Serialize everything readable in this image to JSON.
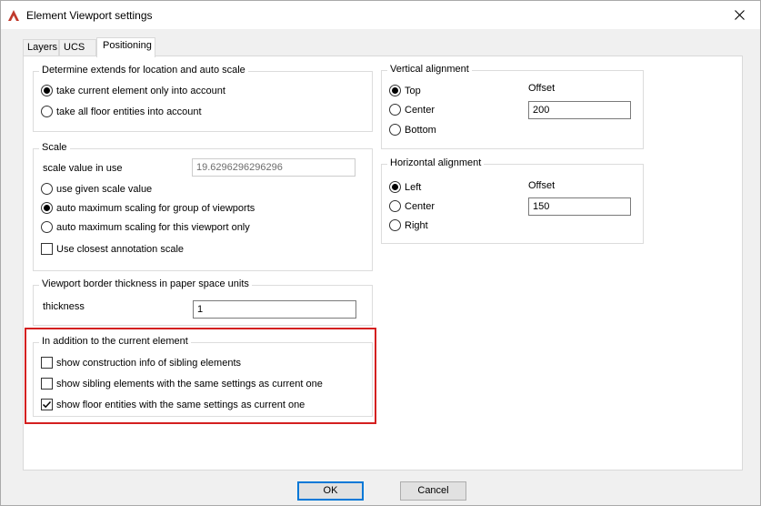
{
  "window": {
    "title": "Element Viewport settings"
  },
  "tabs": [
    {
      "label": "Layers"
    },
    {
      "label": "UCS"
    },
    {
      "label": "Positioning"
    }
  ],
  "groups": {
    "extends": {
      "title": "Determine extends for location and auto scale",
      "options": [
        {
          "label": "take current element only into account",
          "selected": true
        },
        {
          "label": "take all floor entities into account",
          "selected": false
        }
      ]
    },
    "scale": {
      "title": "Scale",
      "value_label": "scale value in use",
      "value": "19.6296296296296",
      "options": [
        {
          "label": "use given scale value",
          "selected": false
        },
        {
          "label": "auto maximum scaling for group of viewports",
          "selected": true
        },
        {
          "label": "auto maximum scaling for this viewport only",
          "selected": false
        }
      ],
      "closest_annotation": {
        "label": "Use closest annotation scale",
        "checked": false
      }
    },
    "border": {
      "title": "Viewport border thickness in paper space units",
      "thickness_label": "thickness",
      "thickness_value": "1"
    },
    "addition": {
      "title": "In addition to the current element",
      "checks": [
        {
          "label": "show construction info of sibling elements",
          "checked": false
        },
        {
          "label": "show sibling elements with the same settings as current one",
          "checked": false
        },
        {
          "label": "show floor entities with the same settings as current one",
          "checked": true
        }
      ]
    },
    "vertical": {
      "title": "Vertical alignment",
      "offset_label": "Offset",
      "offset_value": "200",
      "options": [
        {
          "label": "Top",
          "selected": true
        },
        {
          "label": "Center",
          "selected": false
        },
        {
          "label": "Bottom",
          "selected": false
        }
      ]
    },
    "horizontal": {
      "title": "Horizontal alignment",
      "offset_label": "Offset",
      "offset_value": "150",
      "options": [
        {
          "label": "Left",
          "selected": true
        },
        {
          "label": "Center",
          "selected": false
        },
        {
          "label": "Right",
          "selected": false
        }
      ]
    }
  },
  "buttons": {
    "ok": "OK",
    "cancel": "Cancel"
  },
  "colors": {
    "highlight": "#d42020",
    "accent": "#0078d7",
    "app_icon": "#c0392b"
  },
  "icons": {
    "app": "app-logo-icon",
    "close": "close-icon",
    "check": "checkmark-icon"
  }
}
